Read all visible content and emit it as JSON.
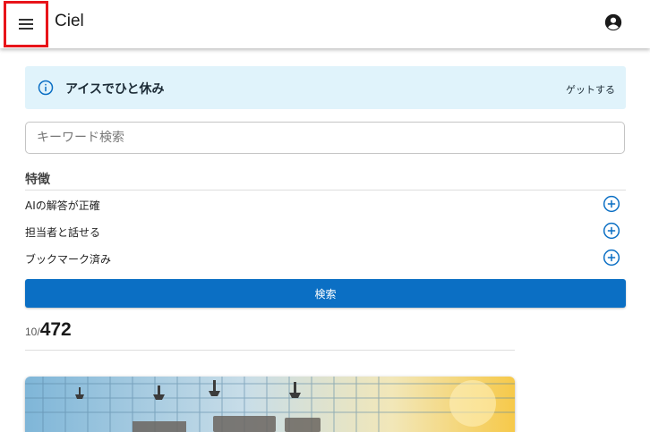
{
  "app": {
    "title": "Ciel",
    "menu_icon": "hamburger-menu-icon",
    "account_icon": "account-circle-icon"
  },
  "banner": {
    "icon": "info-icon",
    "title": "アイスでひと休み",
    "link_label": "ゲットする",
    "background": "#e0f3fb",
    "accent": "#0b6fc4"
  },
  "search": {
    "placeholder": "キーワード検索",
    "value": ""
  },
  "features": {
    "heading": "特徴",
    "items": [
      {
        "label": "AIの解答が正確",
        "icon": "plus-circle-icon"
      },
      {
        "label": "担当者と話せる",
        "icon": "plus-circle-icon"
      },
      {
        "label": "ブックマーク済み",
        "icon": "plus-circle-icon"
      }
    ]
  },
  "search_button": {
    "label": "検索",
    "color": "#0b6fc4"
  },
  "results": {
    "shown": "10/",
    "total": "472"
  },
  "colors": {
    "highlight_border": "#e8141a",
    "primary": "#0b6fc4"
  }
}
